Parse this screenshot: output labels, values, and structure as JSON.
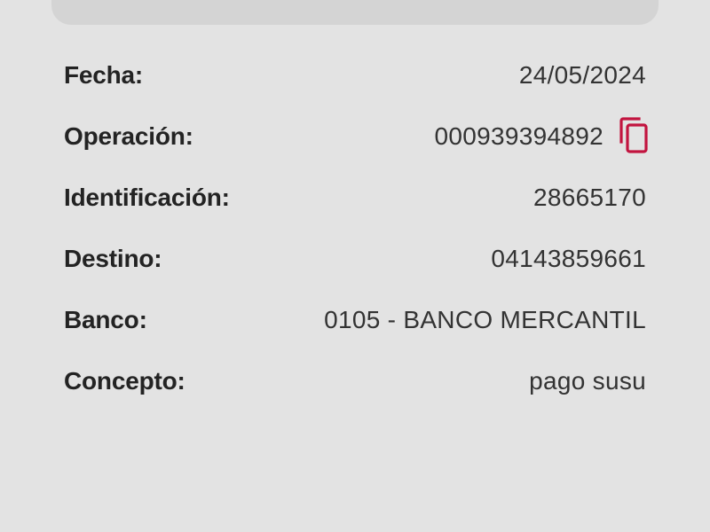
{
  "colors": {
    "background": "#e3e3e3",
    "card": "#d4d4d4",
    "accent": "#c2143f"
  },
  "details": {
    "rows": [
      {
        "label": "Fecha:",
        "value": "24/05/2024"
      },
      {
        "label": "Operación:",
        "value": "000939394892",
        "action_icon": "copy-icon"
      },
      {
        "label": "Identificación:",
        "value": "28665170"
      },
      {
        "label": "Destino:",
        "value": "04143859661"
      },
      {
        "label": "Banco:",
        "value": "0105 - BANCO MERCANTIL"
      },
      {
        "label": "Concepto:",
        "value": "pago susu"
      }
    ]
  }
}
